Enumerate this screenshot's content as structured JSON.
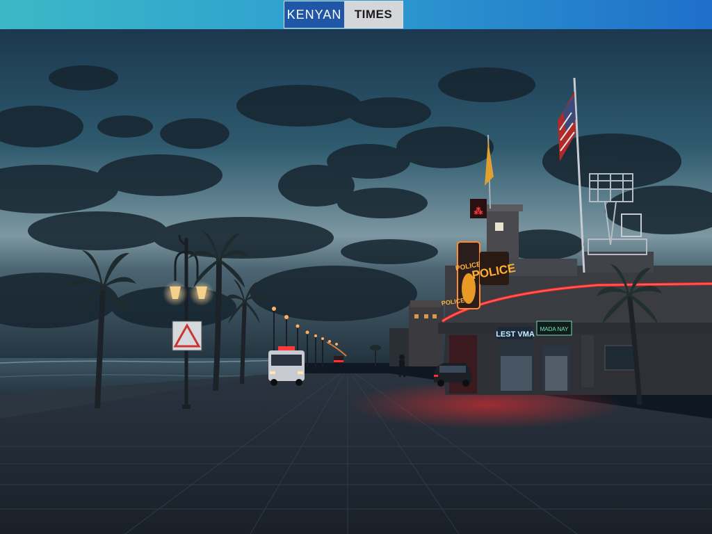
{
  "header": {
    "logo_left": "KENYAN",
    "logo_right": "TIMES"
  },
  "scene": {
    "signs": {
      "police": "POLICE",
      "side_upper": "POLICE",
      "side_lower": "POLICE",
      "shop_left": "LEST VMA",
      "shop_right": "MADA NAY"
    }
  },
  "colors": {
    "neon_red": "#ff2a2a",
    "neon_orange": "#ffb030",
    "sky_top": "#1c3a52",
    "sky_horizon": "#8fa6ad"
  }
}
